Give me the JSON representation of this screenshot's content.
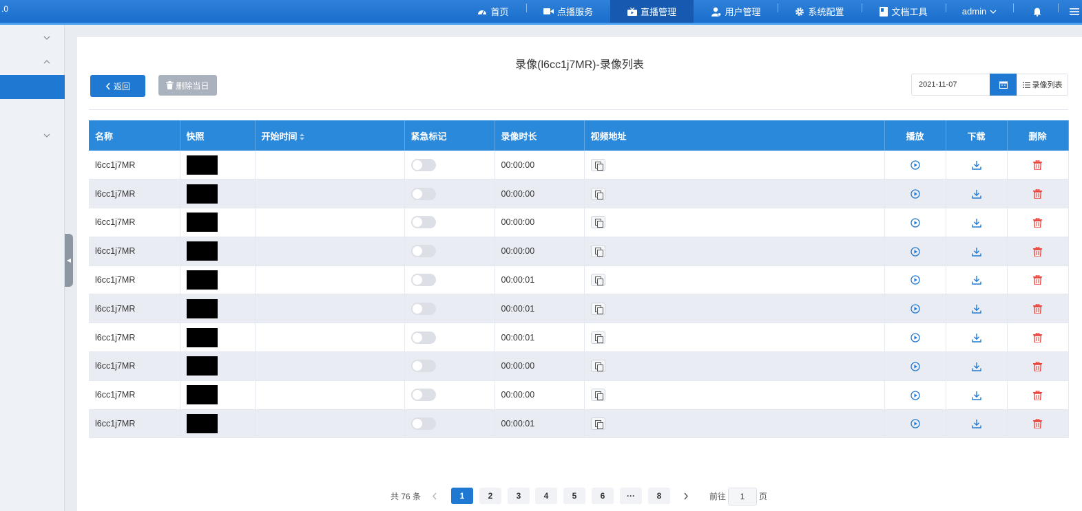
{
  "topbar": {
    "version": ".0",
    "nav": [
      {
        "label": "首页",
        "icon": "dashboard-icon"
      },
      {
        "label": "点播服务",
        "icon": "video-camera-icon"
      },
      {
        "label": "直播管理",
        "icon": "live-tv-icon",
        "active": true
      },
      {
        "label": "用户管理",
        "icon": "user-icon"
      },
      {
        "label": "系统配置",
        "icon": "gear-icon"
      },
      {
        "label": "文档工具",
        "icon": "document-icon"
      }
    ],
    "user": "admin",
    "bell_icon": "bell-icon",
    "menu_icon": "hamburger-icon"
  },
  "page": {
    "title": "录像(l6cc1j7MR)-录像列表",
    "back_label": "返回",
    "delete_day_label": "删除当日",
    "date_value": "2021-11-07",
    "list_label": "录像列表"
  },
  "table": {
    "headers": [
      "名称",
      "快照",
      "开始时间",
      "紧急标记",
      "录像时长",
      "视频地址",
      "播放",
      "下载",
      "删除"
    ],
    "rows": [
      {
        "name": "l6cc1j7MR",
        "duration": "00:00:00"
      },
      {
        "name": "l6cc1j7MR",
        "duration": "00:00:00"
      },
      {
        "name": "l6cc1j7MR",
        "duration": "00:00:00"
      },
      {
        "name": "l6cc1j7MR",
        "duration": "00:00:00"
      },
      {
        "name": "l6cc1j7MR",
        "duration": "00:00:01"
      },
      {
        "name": "l6cc1j7MR",
        "duration": "00:00:01"
      },
      {
        "name": "l6cc1j7MR",
        "duration": "00:00:01"
      },
      {
        "name": "l6cc1j7MR",
        "duration": "00:00:00"
      },
      {
        "name": "l6cc1j7MR",
        "duration": "00:00:00"
      },
      {
        "name": "l6cc1j7MR",
        "duration": "00:00:01"
      }
    ]
  },
  "pagination": {
    "total_text": "共 76 条",
    "pages": [
      "1",
      "2",
      "3",
      "4",
      "5",
      "6",
      "···",
      "8"
    ],
    "current": "1",
    "goto_prefix": "前往",
    "goto_value": "1",
    "goto_suffix": "页"
  },
  "colors": {
    "primary": "#1f78d1",
    "header_bg": "#2b89dc",
    "delete_red": "#e8473f"
  }
}
